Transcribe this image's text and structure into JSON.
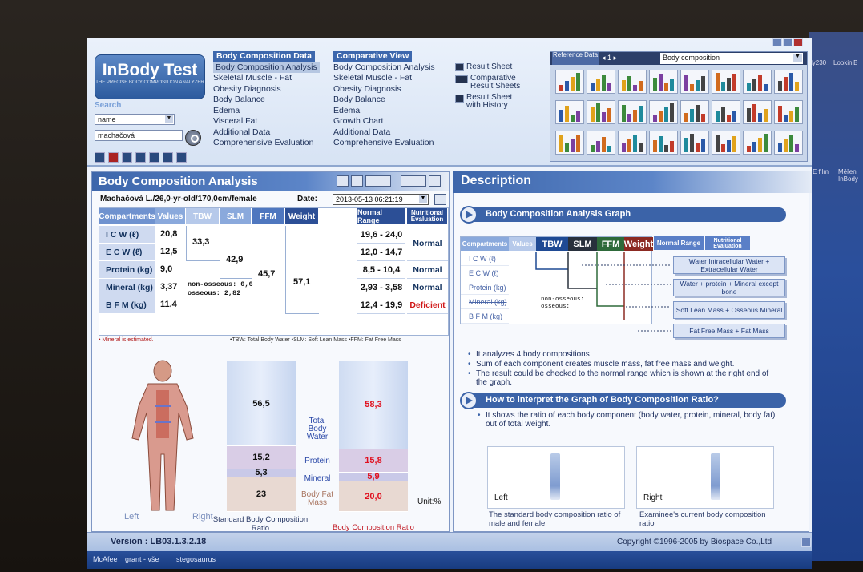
{
  "app": {
    "logo": "InBody Test",
    "logo_sub": "THE PRECISE BODY COMPOSITION ANALYZER",
    "version": "Version : LB03.1.3.2.18",
    "copyright": "Copyright ©1996-2005 by Biospace Co.,Ltd"
  },
  "search": {
    "label": "Search",
    "field": "name",
    "value": "machačová"
  },
  "menus": {
    "data": {
      "title": "Body Composition Data",
      "items": [
        "Body Composition Analysis",
        "Skeletal Muscle - Fat",
        "Obesity Diagnosis",
        "Body Balance",
        "Edema",
        "Visceral Fat",
        "Additional Data",
        "Comprehensive Evaluation"
      ]
    },
    "comparative": {
      "title": "Comparative View",
      "items": [
        "Body Composition Analysis",
        "Skeletal Muscle - Fat",
        "Obesity Diagnosis",
        "Body Balance",
        "Edema",
        "Growth Chart",
        "Additional Data",
        "Comprehensive Evaluation"
      ]
    },
    "results": [
      "Result Sheet",
      "Comparative Result Sheets",
      "Result Sheet with History"
    ]
  },
  "reference": {
    "title": "Reference Data",
    "nav": "◂ 1 ▸",
    "dropdown": "Body composition"
  },
  "analysis": {
    "title": "Body Composition Analysis",
    "patient": "Machačová L./26,0-yr-old/170,0cm/female",
    "date_label": "Date:",
    "date": "2013-05-13 06:21:19",
    "headers": [
      "Compartments",
      "Values",
      "TBW",
      "SLM",
      "FFM",
      "Weight",
      "Normal Range",
      "Nutritional Evaluation"
    ],
    "rows": [
      {
        "label": "I C W (ℓ)",
        "value": "20,8",
        "range": "19,6 - 24,0"
      },
      {
        "label": "E C W (ℓ)",
        "value": "12,5",
        "range": "12,0 - 14,7"
      },
      {
        "label": "Protein (kg)",
        "value": "9,0",
        "range": "8,5 - 10,4"
      },
      {
        "label": "Mineral (kg)",
        "value": "3,37",
        "range": "2,93 - 3,58"
      },
      {
        "label": "B F M (kg)",
        "value": "11,4",
        "range": "12,4 - 19,9"
      }
    ],
    "tbw": "33,3",
    "slm": "42,9",
    "ffm": "45,7",
    "weight": "57,1",
    "non_osseous": "non-osseous: 0,6",
    "osseous": "osseous: 2,82",
    "eval_water": "Normal",
    "eval_protein": "Normal",
    "eval_mineral": "Normal",
    "eval_fat": "Deficient",
    "footnote_left": "• Mineral is estimated.",
    "footnote_right": "•TBW: Total Body Water •SLM: Soft Lean Mass •FFM: Fat Free Mass"
  },
  "ratio": {
    "left": "Left",
    "right": "Right",
    "unit": "Unit:%",
    "standard": [
      56.5,
      15.2,
      5.3,
      23
    ],
    "examinee": [
      58.3,
      15.8,
      5.9,
      20.0
    ],
    "standard_labels": [
      "56,5",
      "15,2",
      "5,3",
      "23"
    ],
    "examinee_labels": [
      "58,3",
      "15,8",
      "5,9",
      "20,0"
    ],
    "components": [
      "Total Body Water",
      "Protein",
      "Mineral",
      "Body Fat Mass"
    ],
    "caption_standard": "Standard Body Composition Ratio",
    "caption_examinee": "Body Composition Ratio"
  },
  "description": {
    "title": "Description",
    "graph_title": "Body Composition Analysis Graph",
    "mini_headers": [
      "Compartments",
      "Values",
      "TBW",
      "SLM",
      "FFM",
      "Weight",
      "Normal Range",
      "Nutritional Evaluation"
    ],
    "mini_rows": [
      "I C W (ℓ)",
      "E C W (ℓ)",
      "Protein (kg)",
      "Mineral (kg)",
      "B F M (kg)"
    ],
    "mini_non_osseous": "non-osseous:",
    "mini_osseous": "osseous:",
    "explain": [
      "Water Intracellular Water + Extracellular Water",
      "Water + protein + Mineral except bone",
      "Soft Lean Mass + Osseous Mineral",
      "Fat Free Mass + Fat Mass"
    ],
    "bullets": [
      "It analyzes 4 body compositions",
      "Sum of each component creates muscle mass, fat free mass and weight.",
      "The result could be checked to the normal range which is shown at the right end of the graph."
    ],
    "ratio_title": "How to interpret the Graph of Body Composition Ratio?",
    "ratio_text": "It shows the ratio of each body component (body water, protein, mineral, body fat) out of total weight.",
    "left_label": "Left",
    "right_label": "Right",
    "left_caption": "The standard body composition ratio of male and female",
    "right_caption": "Examinee's current body composition ratio"
  },
  "taskbar": [
    "McAfee",
    "grant - vše",
    "stegosaurus"
  ],
  "desktop": [
    "ly230",
    "Lookin'B",
    "E film",
    "Měřen InBody"
  ],
  "colors": {
    "accent": "#3c67ad",
    "deficient": "#d01818",
    "examinee_values": "#e0101f"
  }
}
